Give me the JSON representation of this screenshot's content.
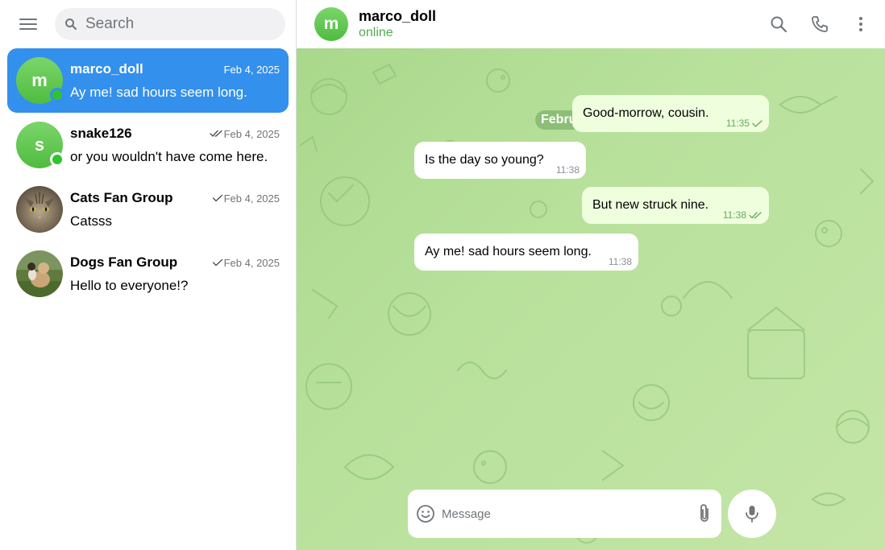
{
  "search": {
    "placeholder": "Search"
  },
  "chats": [
    {
      "name": "marco_doll",
      "avatar_letter": "m",
      "date": "Feb 4, 2025",
      "preview": "Ay me! sad hours seem long.",
      "active": true,
      "online": true,
      "status_icon": "none"
    },
    {
      "name": "snake126",
      "avatar_letter": "s",
      "date": "Feb 4, 2025",
      "preview": "or you wouldn't have come here.",
      "active": false,
      "online": true,
      "status_icon": "double-check-icon"
    },
    {
      "name": "Cats Fan Group",
      "avatar_image": "cat-photo",
      "date": "Feb 4, 2025",
      "preview": "Catsss",
      "active": false,
      "online": false,
      "status_icon": "check-icon"
    },
    {
      "name": "Dogs Fan Group",
      "avatar_image": "dog-photo",
      "date": "Feb 4, 2025",
      "preview": "Hello to everyone!?",
      "active": false,
      "online": false,
      "status_icon": "check-icon"
    }
  ],
  "header": {
    "name": "marco_doll",
    "avatar_letter": "m",
    "status": "online"
  },
  "date_separator": "February 4, 2025",
  "messages": [
    {
      "text": "Good-morrow, cousin.",
      "time": "11:35",
      "direction": "out",
      "status_icon": "check-icon"
    },
    {
      "text": "Is the day so young?",
      "time": "11:38",
      "direction": "in"
    },
    {
      "text": "But new struck nine.",
      "time": "11:38",
      "direction": "out",
      "status_icon": "double-check-icon"
    },
    {
      "text": "Ay me! sad hours seem long.",
      "time": "11:38",
      "direction": "in"
    }
  ],
  "composer": {
    "placeholder": "Message"
  },
  "colors": {
    "accent": "#3390ec",
    "online": "#4fae4e",
    "outgoing_bubble": "#efffde",
    "chat_background": "#b8e19c"
  }
}
